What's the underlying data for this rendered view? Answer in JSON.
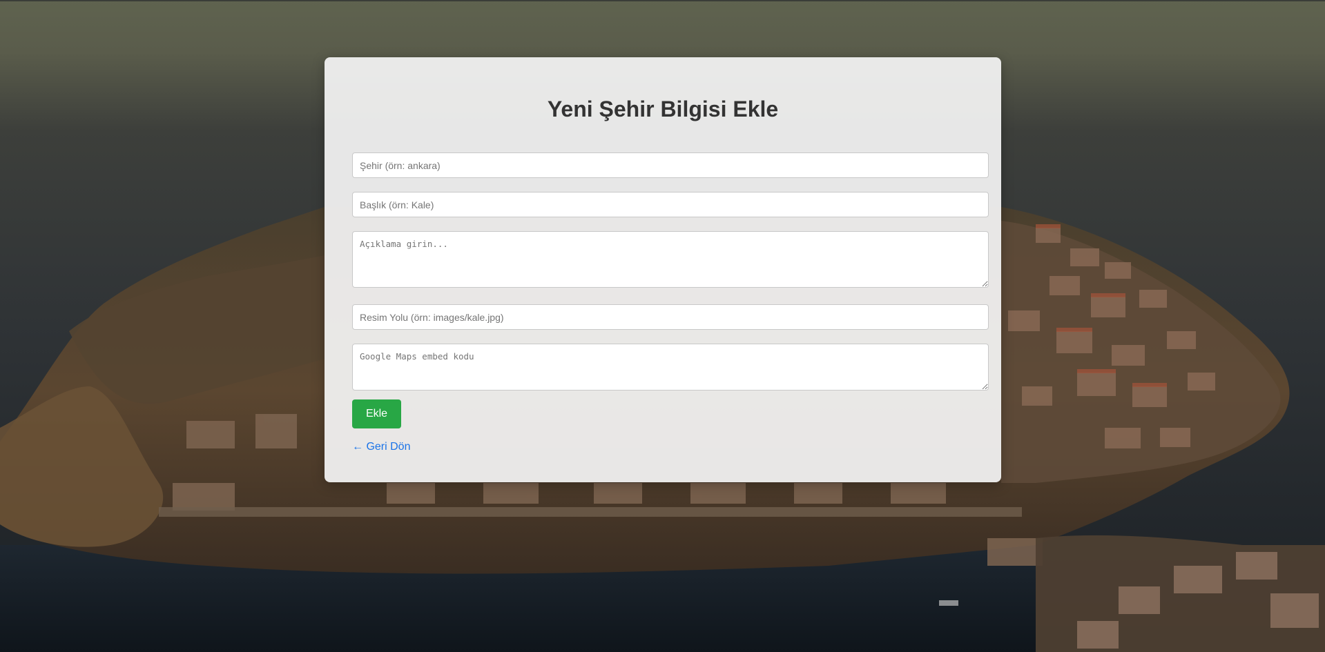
{
  "form": {
    "title": "Yeni Şehir Bilgisi Ekle",
    "city_placeholder": "Şehir (örn: ankara)",
    "heading_placeholder": "Başlık (örn: Kale)",
    "description_placeholder": "Açıklama girin...",
    "image_path_placeholder": "Resim Yolu (örn: images/kale.jpg)",
    "map_embed_placeholder": "Google Maps embed kodu",
    "submit_label": "Ekle",
    "back_link_label": "← Geri Dön"
  },
  "colors": {
    "submit_button": "#28a745",
    "link": "#1a73e8",
    "title_text": "#333333",
    "card_background": "#f4f4f4"
  }
}
